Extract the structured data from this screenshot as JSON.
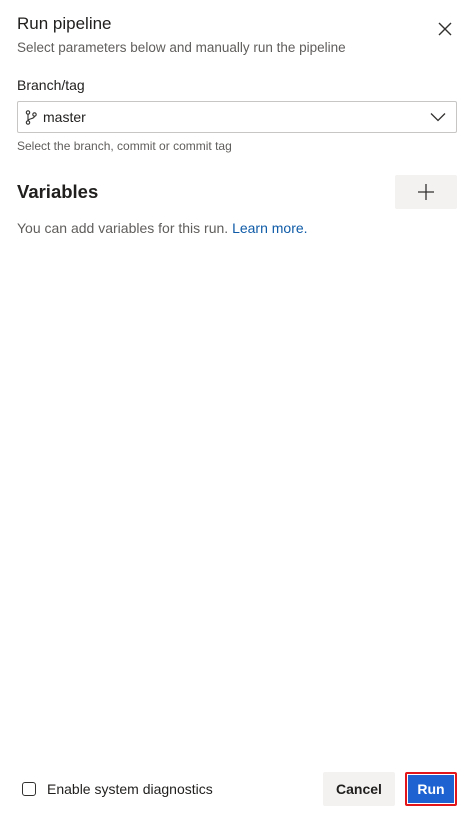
{
  "header": {
    "title": "Run pipeline",
    "subtitle": "Select parameters below and manually run the pipeline",
    "close_icon": "close-icon"
  },
  "branch": {
    "label": "Branch/tag",
    "value": "master",
    "icon": "git-branch-icon",
    "helper": "Select the branch, commit or commit tag"
  },
  "variables": {
    "title": "Variables",
    "add_icon": "plus-icon",
    "description": "You can add variables for this run.",
    "learn_more": "Learn more."
  },
  "footer": {
    "checkbox_label": "Enable system diagnostics",
    "checkbox_checked": false,
    "cancel_label": "Cancel",
    "run_label": "Run"
  },
  "colors": {
    "primary": "#1e62d1",
    "link": "#0f5ba7",
    "highlight_border": "#e2151b",
    "secondary_button": "#f3f2f1"
  }
}
